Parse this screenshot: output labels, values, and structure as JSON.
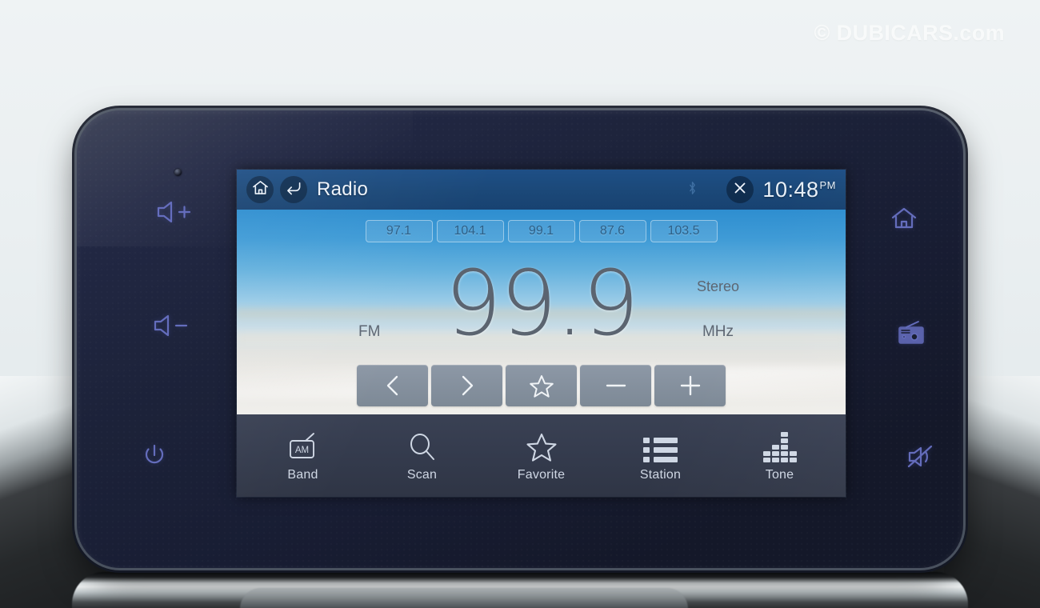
{
  "watermark": {
    "text": "© DUBICARS.com"
  },
  "screen": {
    "titlebar": {
      "home_icon": "home-icon",
      "back_icon": "back-arrow-icon",
      "title": "Radio",
      "bluetooth_icon": "bluetooth-icon",
      "close_icon": "close-icon",
      "clock_time": "10:48",
      "clock_ampm": "PM"
    },
    "presets": [
      {
        "label": "97.1"
      },
      {
        "label": "104.1"
      },
      {
        "label": "99.1"
      },
      {
        "label": "87.6"
      },
      {
        "label": "103.5"
      }
    ],
    "tuner": {
      "band": "FM",
      "frequency": "99.9",
      "unit": "MHz",
      "stereo": "Stereo"
    },
    "controls": [
      {
        "name": "previous-station-button",
        "icon": "chevron-left-icon"
      },
      {
        "name": "next-station-button",
        "icon": "chevron-right-icon"
      },
      {
        "name": "favorite-button",
        "icon": "star-icon"
      },
      {
        "name": "tune-down-button",
        "icon": "minus-icon"
      },
      {
        "name": "tune-up-button",
        "icon": "plus-icon"
      }
    ],
    "navbar": [
      {
        "label": "Band",
        "icon": "am-radio-icon"
      },
      {
        "label": "Scan",
        "icon": "search-icon"
      },
      {
        "label": "Favorite",
        "icon": "star-icon"
      },
      {
        "label": "Station",
        "icon": "list-icon"
      },
      {
        "label": "Tone",
        "icon": "equalizer-icon"
      }
    ],
    "colors": {
      "titlebar_blue": "#1b4878",
      "navbar_slate": "#343b4d",
      "button_grey": "#8d98a6",
      "freq_text": "#5b6470"
    }
  },
  "bezel": {
    "left_buttons": [
      {
        "name": "volume-up-button",
        "icon": "volume-up-icon"
      },
      {
        "name": "volume-down-button",
        "icon": "volume-down-icon"
      },
      {
        "name": "power-button",
        "icon": "power-icon"
      }
    ],
    "right_buttons": [
      {
        "name": "home-button",
        "icon": "home-icon"
      },
      {
        "name": "radio-button",
        "icon": "radio-icon"
      },
      {
        "name": "mute-button",
        "icon": "mute-icon"
      }
    ],
    "accent_color": "#6b74c8",
    "sensor": "sensor-pinhole"
  }
}
